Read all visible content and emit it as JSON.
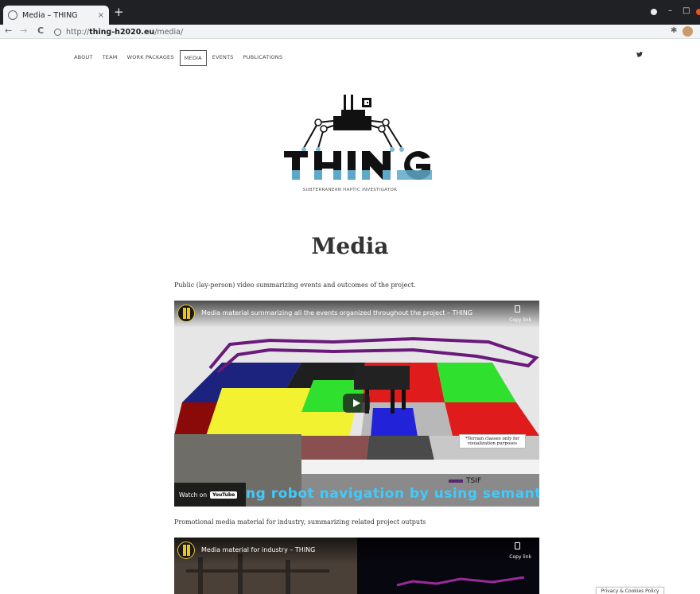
{
  "browser": {
    "tab_title": "Media – THING",
    "tab_close": "×",
    "new_tab": "+",
    "url_scheme": "http://",
    "url_domain": "thing-h2020.eu",
    "url_path": "/media/",
    "back": "←",
    "forward": "→",
    "reload": "C",
    "window_controls": [
      "–",
      "□"
    ]
  },
  "site_nav": {
    "items": [
      "ABOUT",
      "TEAM",
      "WORK PACKAGES",
      "MEDIA",
      "EVENTS",
      "PUBLICATIONS"
    ],
    "active": "MEDIA",
    "social_icon": "twitter-icon"
  },
  "logo": {
    "wordmark": "THING",
    "tagline": "SUBTERRANEAN HAPTIC INVESTIGATOR"
  },
  "page": {
    "heading": "Media",
    "para1": "Public (lay-person) video summarizing events and outcomes of the project.",
    "para2": "Promotional media material for industry, summarizing related project outputs"
  },
  "video1": {
    "title": "Media material summarizing all the events organized throughout the project – THING",
    "copy_label": "Copy link",
    "watch_on": "Watch on",
    "youtube": "YouTube",
    "subtitle": "ng robot navigation by using semantic",
    "legend_label": "TSIF",
    "note": "*Terrain classes only for visualization purposes"
  },
  "video2": {
    "title": "Media material for industry – THING",
    "copy_label": "Copy link"
  },
  "cookie": {
    "label": "Privacy & Cookies Policy"
  }
}
